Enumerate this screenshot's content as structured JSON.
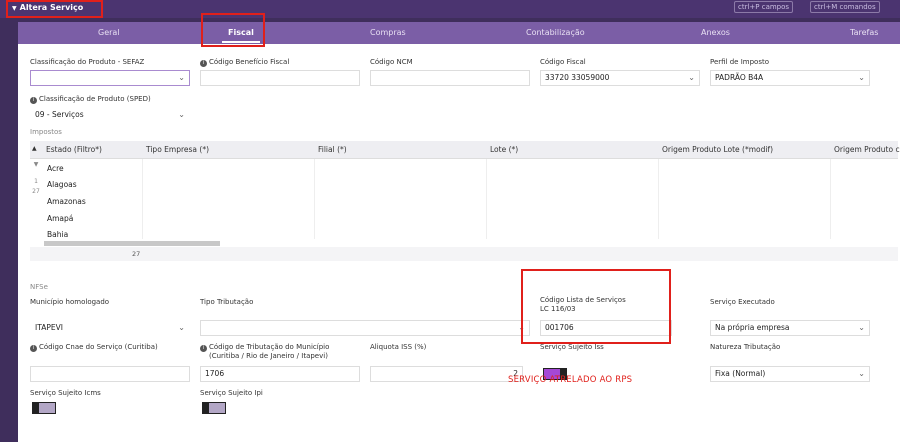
{
  "header": {
    "title": "Altera Serviço",
    "shortcut_fields": "ctrl+P campos",
    "shortcut_commands": "ctrl+M comandos"
  },
  "tabs": [
    {
      "label": "Geral"
    },
    {
      "label": "Fiscal",
      "active": true
    },
    {
      "label": "Compras"
    },
    {
      "label": "Contabilização"
    },
    {
      "label": "Anexos"
    },
    {
      "label": "Tarefas"
    }
  ],
  "fiscal": {
    "classificacao_sefaz": {
      "label": "Classificação do Produto - SEFAZ",
      "value": ""
    },
    "codigo_beneficio": {
      "label": "Código Benefício Fiscal",
      "value": ""
    },
    "codigo_ncm": {
      "label": "Código NCM",
      "value": ""
    },
    "codigo_fiscal": {
      "label": "Código Fiscal",
      "value": "33720 33059000"
    },
    "perfil_imposto": {
      "label": "Perfil de Imposto",
      "value": "PADRÃO B4A"
    },
    "classificacao_sped": {
      "label": "Classificação de Produto (SPED)",
      "value": "09 - Serviços"
    }
  },
  "impostos": {
    "section_label": "Impostos",
    "columns": [
      "Estado (Filtro*)",
      "Tipo Empresa (*)",
      "Filial (*)",
      "Lote (*)",
      "Origem Produto Lote (*modif)",
      "Origem Produto c"
    ],
    "rows": [
      "Acre",
      "Alagoas",
      "Amazonas",
      "Amapá",
      "Bahia"
    ],
    "row_number_top": "1",
    "row_number_bottom": "27",
    "footer_count": "27"
  },
  "nfse": {
    "section_label": "NFSe",
    "municipio": {
      "label": "Município homologado",
      "value": "ITAPEVI"
    },
    "tipo_tributacao": {
      "label": "Tipo Tributação",
      "value": ""
    },
    "codigo_lista": {
      "label": "Código Lista de Serviços",
      "sublabel": "LC 116/03",
      "value": "001706"
    },
    "servico_executado": {
      "label": "Serviço Executado",
      "value": "Na própria empresa"
    },
    "codigo_cnae": {
      "label": "Código Cnae do Serviço (Curitiba)",
      "value": ""
    },
    "codigo_tributacao": {
      "label": "Código de Tributação do Município",
      "sublabel": "(Curitiba / Rio de Janeiro / Itapevi)",
      "value": "1706"
    },
    "aliquota_iss": {
      "label": "Aliquota ISS (%)",
      "value": "2"
    },
    "servico_sujeito_iss": {
      "label": "Serviço Sujeito Iss",
      "on": true
    },
    "natureza_tributacao": {
      "label": "Natureza Tributação",
      "value": "Fixa (Normal)"
    },
    "servico_sujeito_icms": {
      "label": "Serviço Sujeito Icms",
      "on": false
    },
    "servico_sujeito_ipi": {
      "label": "Serviço Sujeito Ipi",
      "on": false
    }
  },
  "annotation": "SERVIÇO ATRELADO AO RPS",
  "colors": {
    "accent": "#7b5ea6",
    "toggle_on": "#a548d6",
    "annotation_red": "#e0201b"
  }
}
